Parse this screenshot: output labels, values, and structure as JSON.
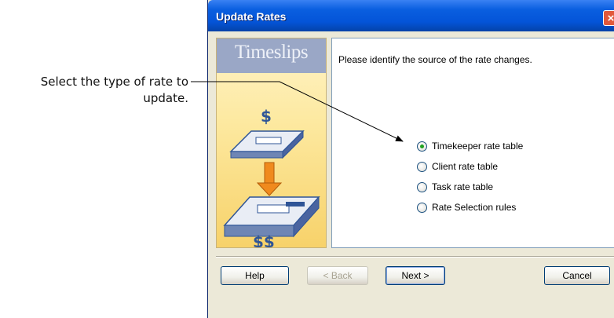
{
  "callout": {
    "line1": "Select the type of rate to",
    "line2": "update."
  },
  "dialog": {
    "title": "Update Rates",
    "close_glyph": "×",
    "logo_text": "Timeslips",
    "sidebar_symbols": {
      "top": "$",
      "bottom": "$$"
    },
    "prompt": "Please identify the source of the rate changes.",
    "options": [
      {
        "label": "Timekeeper rate table",
        "checked": true
      },
      {
        "label": "Client rate table",
        "checked": false
      },
      {
        "label": "Task rate table",
        "checked": false
      },
      {
        "label": "Rate Selection rules",
        "checked": false
      }
    ],
    "buttons": {
      "help": "Help",
      "back": "< Back",
      "next": "Next >",
      "cancel": "Cancel"
    }
  },
  "colors": {
    "titlebar": "#0454d8",
    "close": "#e2583b",
    "radio_dot": "#21a121",
    "sidebar": "#f7d26a",
    "logo_band": "#9aa7c6",
    "arrow": "#f08a1d",
    "dollar": "#2f5597"
  }
}
